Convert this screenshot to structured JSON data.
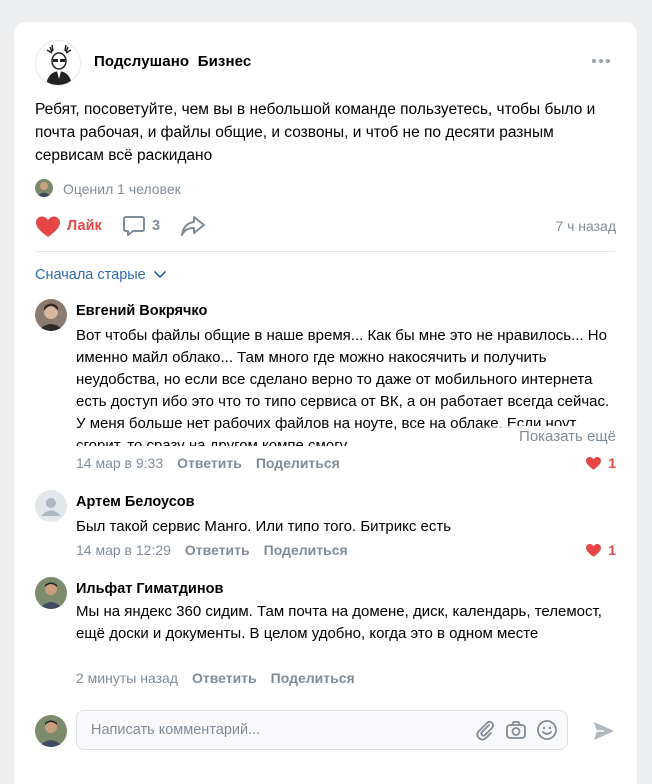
{
  "post": {
    "group_name": "Подслушано  Бизнес",
    "text": "Ребят, посоветуйте, чем вы в небольшой команде пользуетесь, чтобы было и почта рабочая, и файлы общие, и созвоны, и чтоб не по десяти разным сервисам всё раскидано",
    "liked_by": "Оценил 1 человек",
    "like_label": "Лайк",
    "comments_count": "3",
    "time": "7 ч назад"
  },
  "comments": {
    "sort_label": "Сначала старые",
    "items": [
      {
        "author": "Евгений Вокрячко",
        "text": "Вот чтобы файлы общие в наше время... Как бы мне это не нравилось... Но именно майл облако... Там много где можно накосячить и получить неудобства, но если все сделано верно то даже от мобильного интернета есть доступ ибо это что то типо сервиса от ВК, а он работает всегда сейчас. У меня больше нет рабочих файлов на ноуте, все на облаке. Если ноут сгорит, то сразу на другом компе смогу",
        "show_more": "Показать ещё",
        "date": "14 мар в 9:33",
        "reply": "Ответить",
        "share": "Поделиться",
        "likes": "1"
      },
      {
        "author": "Артем Белоусов",
        "text": "Был такой сервис Манго. Или типо того. Битрикс есть",
        "date": "14 мар в 12:29",
        "reply": "Ответить",
        "share": "Поделиться",
        "likes": "1"
      },
      {
        "author": "Ильфат Гиматдинов",
        "text": "Мы на яндекс 360 сидим. Там почта на домене, диск, календарь, телемост, ещё доски и документы. В целом удобно, когда это в одном месте",
        "date": "2 минуты назад",
        "reply": "Ответить",
        "share": "Поделиться"
      }
    ]
  },
  "composer": {
    "placeholder": "Написать комментарий..."
  },
  "colors": {
    "like": "#e64646",
    "link": "#2d6bb0",
    "secondary": "#818c99",
    "background": "#edeef0"
  }
}
